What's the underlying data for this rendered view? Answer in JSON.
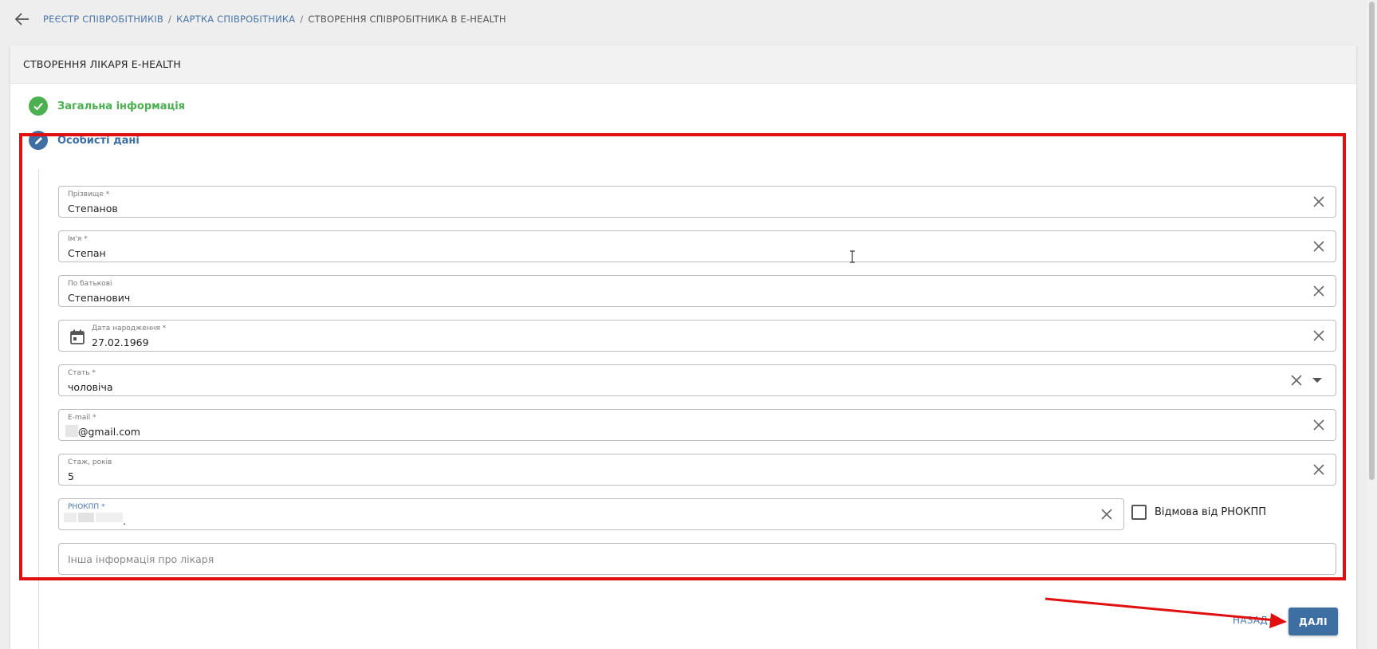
{
  "breadcrumb": {
    "items": [
      "РЕЄСТР СПІВРОБІТНИКІВ",
      "КАРТКА СПІВРОБІТНИКА"
    ],
    "current": "СТВОРЕННЯ СПІВРОБІТНИКА В E-HEALTH",
    "separator": "/"
  },
  "card": {
    "title": "СТВОРЕННЯ ЛІКАРЯ E-HEALTH"
  },
  "steps": {
    "general": "Загальна інформація",
    "personal": "Особисті дані"
  },
  "form": {
    "last_name": {
      "label": "Прізвище *",
      "value": "Степанов"
    },
    "first_name": {
      "label": "Ім'я *",
      "value": "Степан"
    },
    "middle_name": {
      "label": "По батькові",
      "value": "Степанович"
    },
    "birth_date": {
      "label": "Дата народження *",
      "value": "27.02.1969"
    },
    "gender": {
      "label": "Стать *",
      "value": "чоловіча"
    },
    "email": {
      "label": "E-mail *",
      "value": "@gmail.com"
    },
    "experience": {
      "label": "Стаж, років",
      "value": "5"
    },
    "rnokpp": {
      "label": "РНОКПП *",
      "value": "."
    },
    "rnokpp_refusal": "Відмова від РНОКПП",
    "other_info": {
      "placeholder": "Інша інформація про лікаря"
    }
  },
  "buttons": {
    "back": "НАЗАД",
    "next": "ДАЛІ"
  },
  "colors": {
    "accent": "#3d6fa3",
    "success": "#4caf50",
    "highlight": "#e01010",
    "link": "#4a76a8"
  }
}
